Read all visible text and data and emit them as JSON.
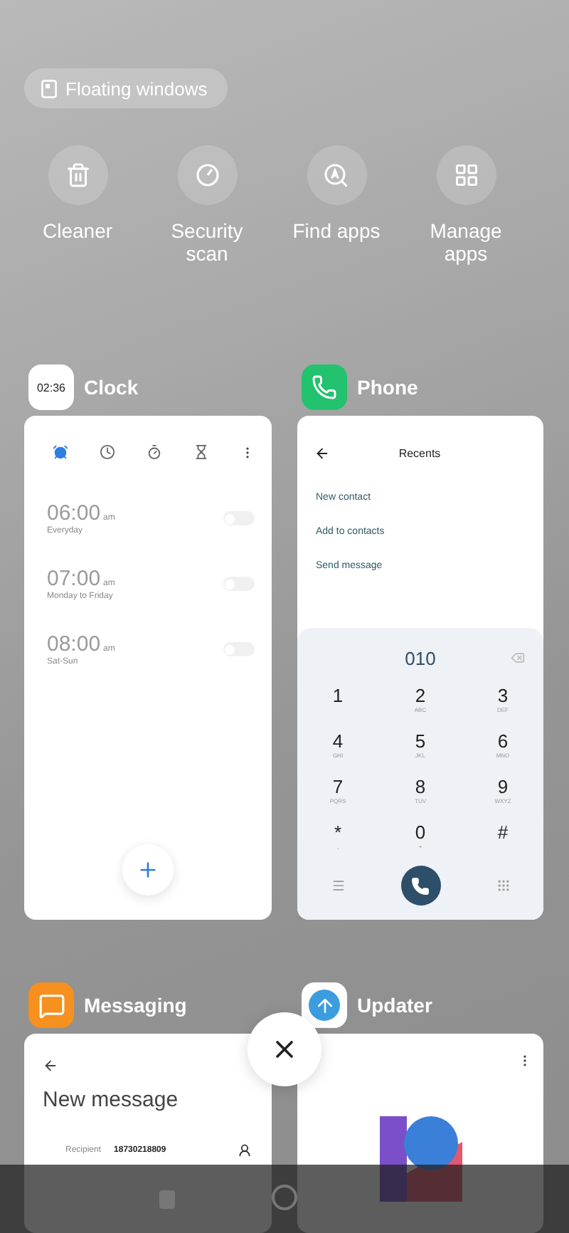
{
  "floating_windows_button": {
    "label": "Floating windows"
  },
  "quick_actions": [
    {
      "kind": "cleaner",
      "label": "Cleaner"
    },
    {
      "kind": "security",
      "label": "Security scan"
    },
    {
      "kind": "find",
      "label": "Find apps"
    },
    {
      "kind": "manage",
      "label": "Manage apps"
    }
  ],
  "recent_apps": [
    {
      "kind": "clock",
      "name": "Clock",
      "icon_text": "02:36",
      "tabs": [
        {
          "kind": "alarm",
          "selected": true
        },
        {
          "kind": "clock",
          "selected": false
        },
        {
          "kind": "stopwatch",
          "selected": false
        },
        {
          "kind": "timer",
          "selected": false
        }
      ],
      "alarms": [
        {
          "time": "06:00",
          "period": "am",
          "repeat": "Everyday",
          "on": false
        },
        {
          "time": "07:00",
          "period": "am",
          "repeat": "Monday to Friday",
          "on": false
        },
        {
          "time": "08:00",
          "period": "am",
          "repeat": "Sat-Sun",
          "on": false
        }
      ]
    },
    {
      "kind": "phone",
      "name": "Phone",
      "title": "Recents",
      "menu_items": [
        "New contact",
        "Add to contacts",
        "Send message"
      ],
      "number": "010",
      "keys": [
        {
          "digit": "1"
        },
        {
          "digit": "2",
          "letters": "ABC"
        },
        {
          "digit": "3",
          "letters": "DEF"
        },
        {
          "digit": "4",
          "letters": "GHI"
        },
        {
          "digit": "5",
          "letters": "JKL"
        },
        {
          "digit": "6",
          "letters": "MNO"
        },
        {
          "digit": "7",
          "letters": "PQRS"
        },
        {
          "digit": "8",
          "letters": "TUV"
        },
        {
          "digit": "9",
          "letters": "WXYZ"
        },
        {
          "digit": "*",
          "letters": ","
        },
        {
          "digit": "0",
          "letters": "+"
        },
        {
          "digit": "#"
        }
      ]
    },
    {
      "kind": "messaging",
      "name": "Messaging",
      "title": "New message",
      "recipient_label": "Recipient",
      "recipient": "18730218809"
    },
    {
      "kind": "updater",
      "name": "Updater"
    }
  ]
}
